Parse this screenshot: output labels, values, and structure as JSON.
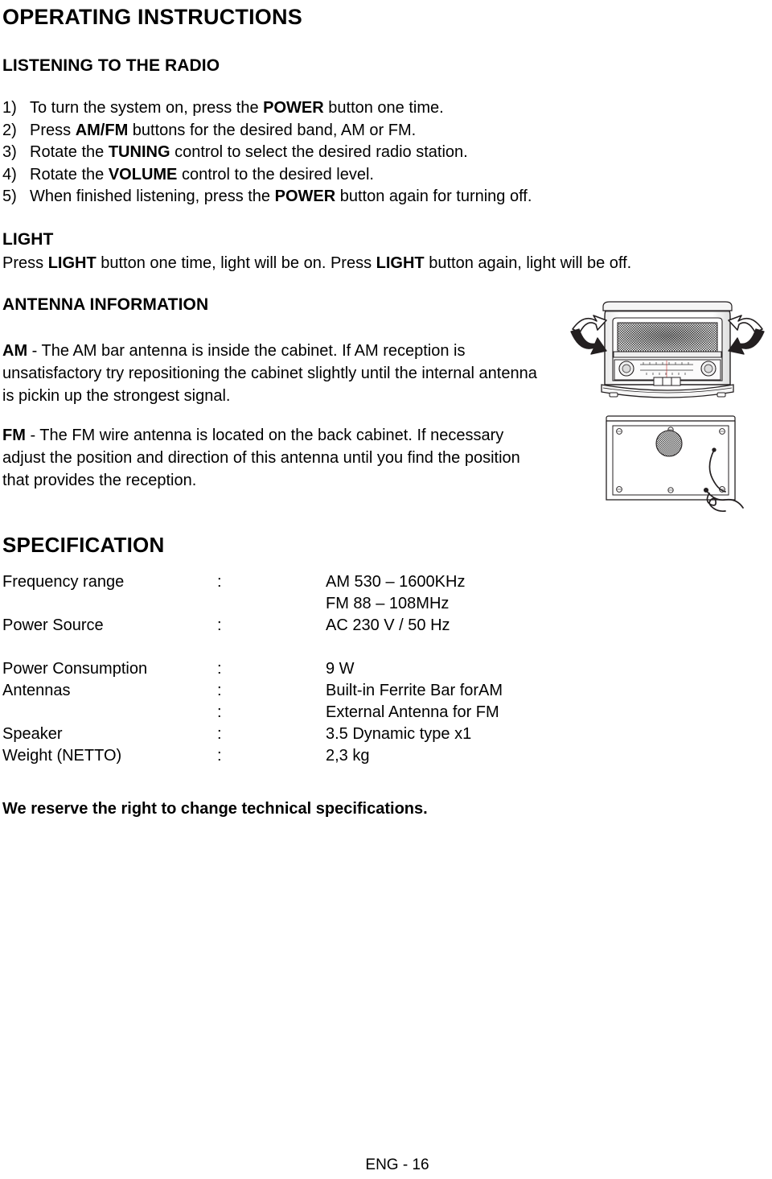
{
  "document": {
    "title": "OPERATING INSTRUCTIONS",
    "footer": "ENG - 16"
  },
  "sections": {
    "listening": {
      "heading": "LISTENING TO THE RADIO",
      "steps": [
        {
          "num": "1)",
          "pre": "To turn the system on, press the ",
          "strong": "POWER",
          "post": " button one time."
        },
        {
          "num": "2)",
          "pre": "Press ",
          "strong": "AM/FM",
          "post": " buttons for the desired band, AM or FM."
        },
        {
          "num": "3)",
          "pre": "Rotate the ",
          "strong": "TUNING",
          "post": " control to select the desired radio station."
        },
        {
          "num": "4)",
          "pre": "Rotate the ",
          "strong": "VOLUME",
          "post": " control to the desired level."
        },
        {
          "num": "5)",
          "pre": "When finished listening, press the ",
          "strong": "POWER",
          "post": " button again for turning off."
        }
      ]
    },
    "light": {
      "heading": "LIGHT",
      "p1_pre": "Press ",
      "p1_strong": "LIGHT",
      "p1_mid": " button one time, light will be on. Press ",
      "p1_strong2": "LIGHT",
      "p1_post": " button again, light will be off."
    },
    "antenna": {
      "heading": "ANTENNA INFORMATION",
      "am_label": "AM",
      "am_text": " - The AM bar antenna is inside the cabinet. If AM reception is unsatisfactory try repositioning the cabinet slightly until the internal antenna is pickin up the strongest signal.",
      "fm_label": "FM",
      "fm_text": " - The FM wire antenna is located on the back cabinet. If necessary adjust the position and direction of this antenna until you find the position that provides the reception."
    },
    "specification": {
      "heading": "SPECIFICATION",
      "colon": ":",
      "rows": [
        {
          "label": "Frequency range",
          "colon": ":",
          "value": "AM 530 – 1600KHz",
          "gap": false
        },
        {
          "label": "",
          "colon": "",
          "value": "FM 88 – 108MHz",
          "gap": false
        },
        {
          "label": "Power Source",
          "colon": ":",
          "value": "AC 230 V / 50 Hz",
          "gap": false
        },
        {
          "label": "Power Consumption",
          "colon": ":",
          "value": "9 W",
          "gap": true
        },
        {
          "label": "Antennas",
          "colon": ":",
          "value": "Built-in Ferrite Bar forAM",
          "gap": false
        },
        {
          "label": "",
          "colon": ":",
          "value": "External Antenna for FM",
          "gap": false
        },
        {
          "label": "Speaker",
          "colon": ":",
          "value": "3.5 Dynamic type x1",
          "gap": false
        },
        {
          "label": "Weight (NETTO)",
          "colon": ":",
          "value": "2,3 kg",
          "gap": false
        }
      ],
      "disclaimer": "We reserve the right to change technical specifications."
    }
  },
  "figures": {
    "front": {
      "name": "radio-front-with-rotation-arrows",
      "description": "Front view of retro table radio with curved rotation arrows on both sides"
    },
    "back": {
      "name": "radio-back-with-fm-wire-antenna",
      "description": "Back panel of radio showing vent, screws and FM wire antenna"
    }
  },
  "colors": {
    "text": "#000000",
    "background": "#ffffff",
    "line": "#231f20",
    "shade": "#8a8a8a"
  }
}
